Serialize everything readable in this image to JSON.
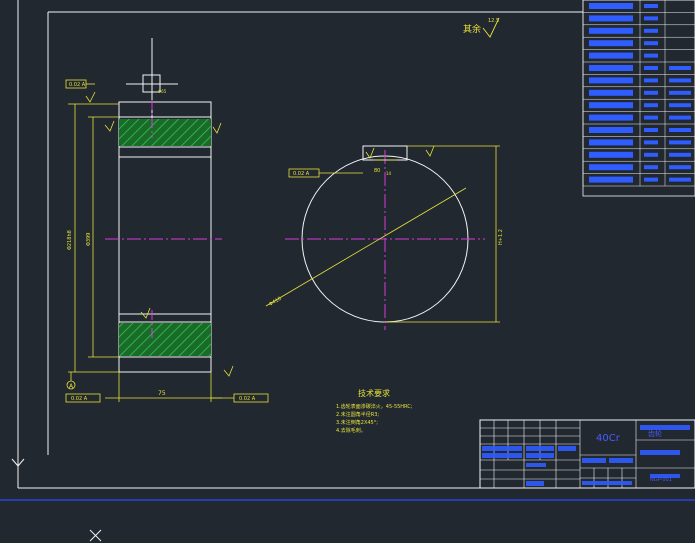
{
  "colors": {
    "background": "#212830",
    "frame": "#ffffff",
    "dimension": "#e8e23a",
    "centerline": "#d83ad8",
    "hatch": "#21a03a",
    "title_block_line": "#4a5cff",
    "bottom_band": "#2a46d6",
    "table_text": "#2f5dff"
  },
  "drawing": {
    "surface_note": "其余",
    "surface_value": "12.5",
    "tech_title": "技术要求",
    "tech_items": [
      "1.齿轮表面渗碳淬火，45-55HRC;",
      "2.未注圆角半径R3;",
      "3.未注倒角2X45°;",
      "4.去除毛刺。"
    ],
    "dim_face_width": "75",
    "dim_dia_left": "Φ399",
    "dim_dia_tolerance": "Φ218h8",
    "dim_gear_od": "Φ410",
    "dim_keyway": "80",
    "dim_key_width": "14",
    "tolerance_flag_1": "0.02 A",
    "tolerance_flag_2": "0.02 A",
    "tolerance_flag_3": "0.02 A",
    "tolerance_flag_4": "0.02 A",
    "datum_label": "A",
    "title_material": "40Cr",
    "title_part_name": "齿轮",
    "title_drawing_no": "NGP-001",
    "param_rows": 15
  }
}
